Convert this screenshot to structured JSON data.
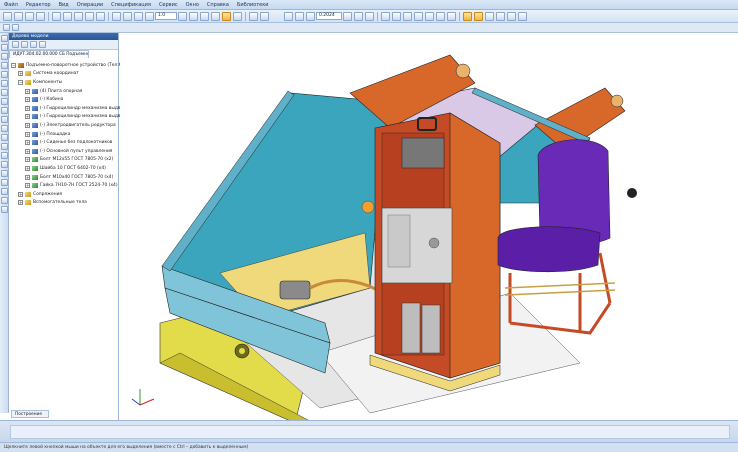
{
  "menubar": {
    "items": [
      "Файл",
      "Редактор",
      "Вид",
      "Операции",
      "Спецификация",
      "Сервис",
      "Окно",
      "Справка",
      "Библиотеки"
    ]
  },
  "toolbar": {
    "scale_value": "1.0",
    "zoom_value": "0.2024"
  },
  "tree": {
    "header": "Дерево модели",
    "tab_label": "ИДУТ.304.02.00.000 СБ Подъемно-поворотное устройство",
    "nodes": [
      {
        "label": "Подъемно-поворотное устройство (Тел:6, Ко:...",
        "icon": "assembly-icon",
        "indent": 0,
        "expander": "−"
      },
      {
        "label": "Система координат",
        "icon": "folder-icon",
        "indent": 1,
        "expander": "+"
      },
      {
        "label": "Компоненты",
        "icon": "folder-icon",
        "indent": 1,
        "expander": "−"
      },
      {
        "label": "(4) Плита опорная",
        "icon": "component-icon",
        "indent": 2,
        "expander": "+"
      },
      {
        "label": "(-) Кабина",
        "icon": "component-icon",
        "indent": 2,
        "expander": "+"
      },
      {
        "label": "(-) Гидроцилиндр механизма выдви...",
        "icon": "component-icon",
        "indent": 2,
        "expander": "+"
      },
      {
        "label": "(-) Гидроцилиндр механизма выдви...",
        "icon": "component-icon",
        "indent": 2,
        "expander": "+"
      },
      {
        "label": "(-) Электродвигатель редуктора",
        "icon": "component-icon",
        "indent": 2,
        "expander": "+"
      },
      {
        "label": "(-) Площадка",
        "icon": "component-icon",
        "indent": 2,
        "expander": "+"
      },
      {
        "label": "(-) Сиденье без подлокотников",
        "icon": "component-icon",
        "indent": 2,
        "expander": "+"
      },
      {
        "label": "(-) Основной пульт управления",
        "icon": "component-icon",
        "indent": 2,
        "expander": "+"
      },
      {
        "label": "Болт М12х55 ГОСТ 7805-70 (х2)",
        "icon": "fastener-icon",
        "indent": 2,
        "expander": "+"
      },
      {
        "label": "Шайба 10 ГОСТ 6402-70 (х4)",
        "icon": "fastener-icon",
        "indent": 2,
        "expander": "+"
      },
      {
        "label": "Болт М10х40 ГОСТ 7805-70 (х4)",
        "icon": "fastener-icon",
        "indent": 2,
        "expander": "+"
      },
      {
        "label": "Гайка 7Н10-7Н ГОСТ 2524-70 (х4)",
        "icon": "fastener-icon",
        "indent": 2,
        "expander": "+"
      },
      {
        "label": "Сопряжения",
        "icon": "folder-icon",
        "indent": 1,
        "expander": "+"
      },
      {
        "label": "Вспомогательные тела",
        "icon": "folder-icon",
        "indent": 1,
        "expander": "+"
      }
    ],
    "footer_tab": "Построение"
  },
  "statusbar": {
    "text": "Щелкните левой кнопкой мыши на объекте для его выделения (вместе с Ctrl – добавить к выделенным)"
  },
  "colors": {
    "frame_blue": "#7fc4d8",
    "frame_orange": "#d8682a",
    "cabinet_red": "#c54a26",
    "seat_purple": "#6a2ab8",
    "base_yellow": "#e3dc4a",
    "floor_lilac": "#d9c8e6"
  }
}
